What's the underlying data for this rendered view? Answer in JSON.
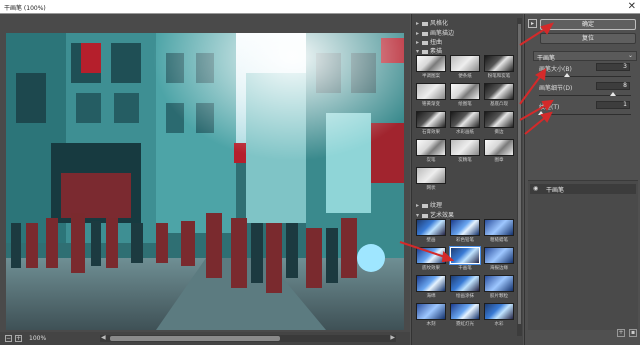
{
  "window": {
    "title": "干画笔 (100%)",
    "close": "✕"
  },
  "preview": {
    "zoom_label": "100%",
    "zoom_out": "−",
    "zoom_in": "+"
  },
  "gallery": {
    "categories": [
      {
        "label": "风格化",
        "expanded": false
      },
      {
        "label": "画笔描边",
        "expanded": false
      },
      {
        "label": "扭曲",
        "expanded": false
      },
      {
        "label": "素描",
        "expanded": true
      },
      {
        "label": "纹理",
        "expanded": false
      },
      {
        "label": "艺术效果",
        "expanded": true
      }
    ],
    "sketch_filters": [
      "半调图案",
      "便条纸",
      "粉笔和炭笔",
      "铬黄渐变",
      "绘图笔",
      "基底凸现",
      "石膏效果",
      "水彩画纸",
      "撕边",
      "炭笔",
      "炭精笔",
      "图章",
      "网状"
    ],
    "art_filters": [
      "壁画",
      "彩色铅笔",
      "粗糙蜡笔",
      "底纹效果",
      "干画笔",
      "海报边缘",
      "海绵",
      "绘画涂抹",
      "胶片颗粒",
      "木刻",
      "霓虹灯光",
      "水彩"
    ],
    "selected": "干画笔"
  },
  "controls": {
    "collapse_icon": "▸",
    "ok_label": "确定",
    "cancel_label": "复位",
    "filter_select": "干画笔",
    "params": [
      {
        "label": "画笔大小(B)",
        "value": "3",
        "max": 10
      },
      {
        "label": "画笔细节(D)",
        "value": "8",
        "max": 10
      },
      {
        "label": "纹理(T)",
        "value": "1",
        "max": 3
      }
    ],
    "layer_name": "干画笔"
  },
  "colors": {
    "annotation_arrow": "#d42a2a",
    "selection": "#4a8fe8"
  }
}
